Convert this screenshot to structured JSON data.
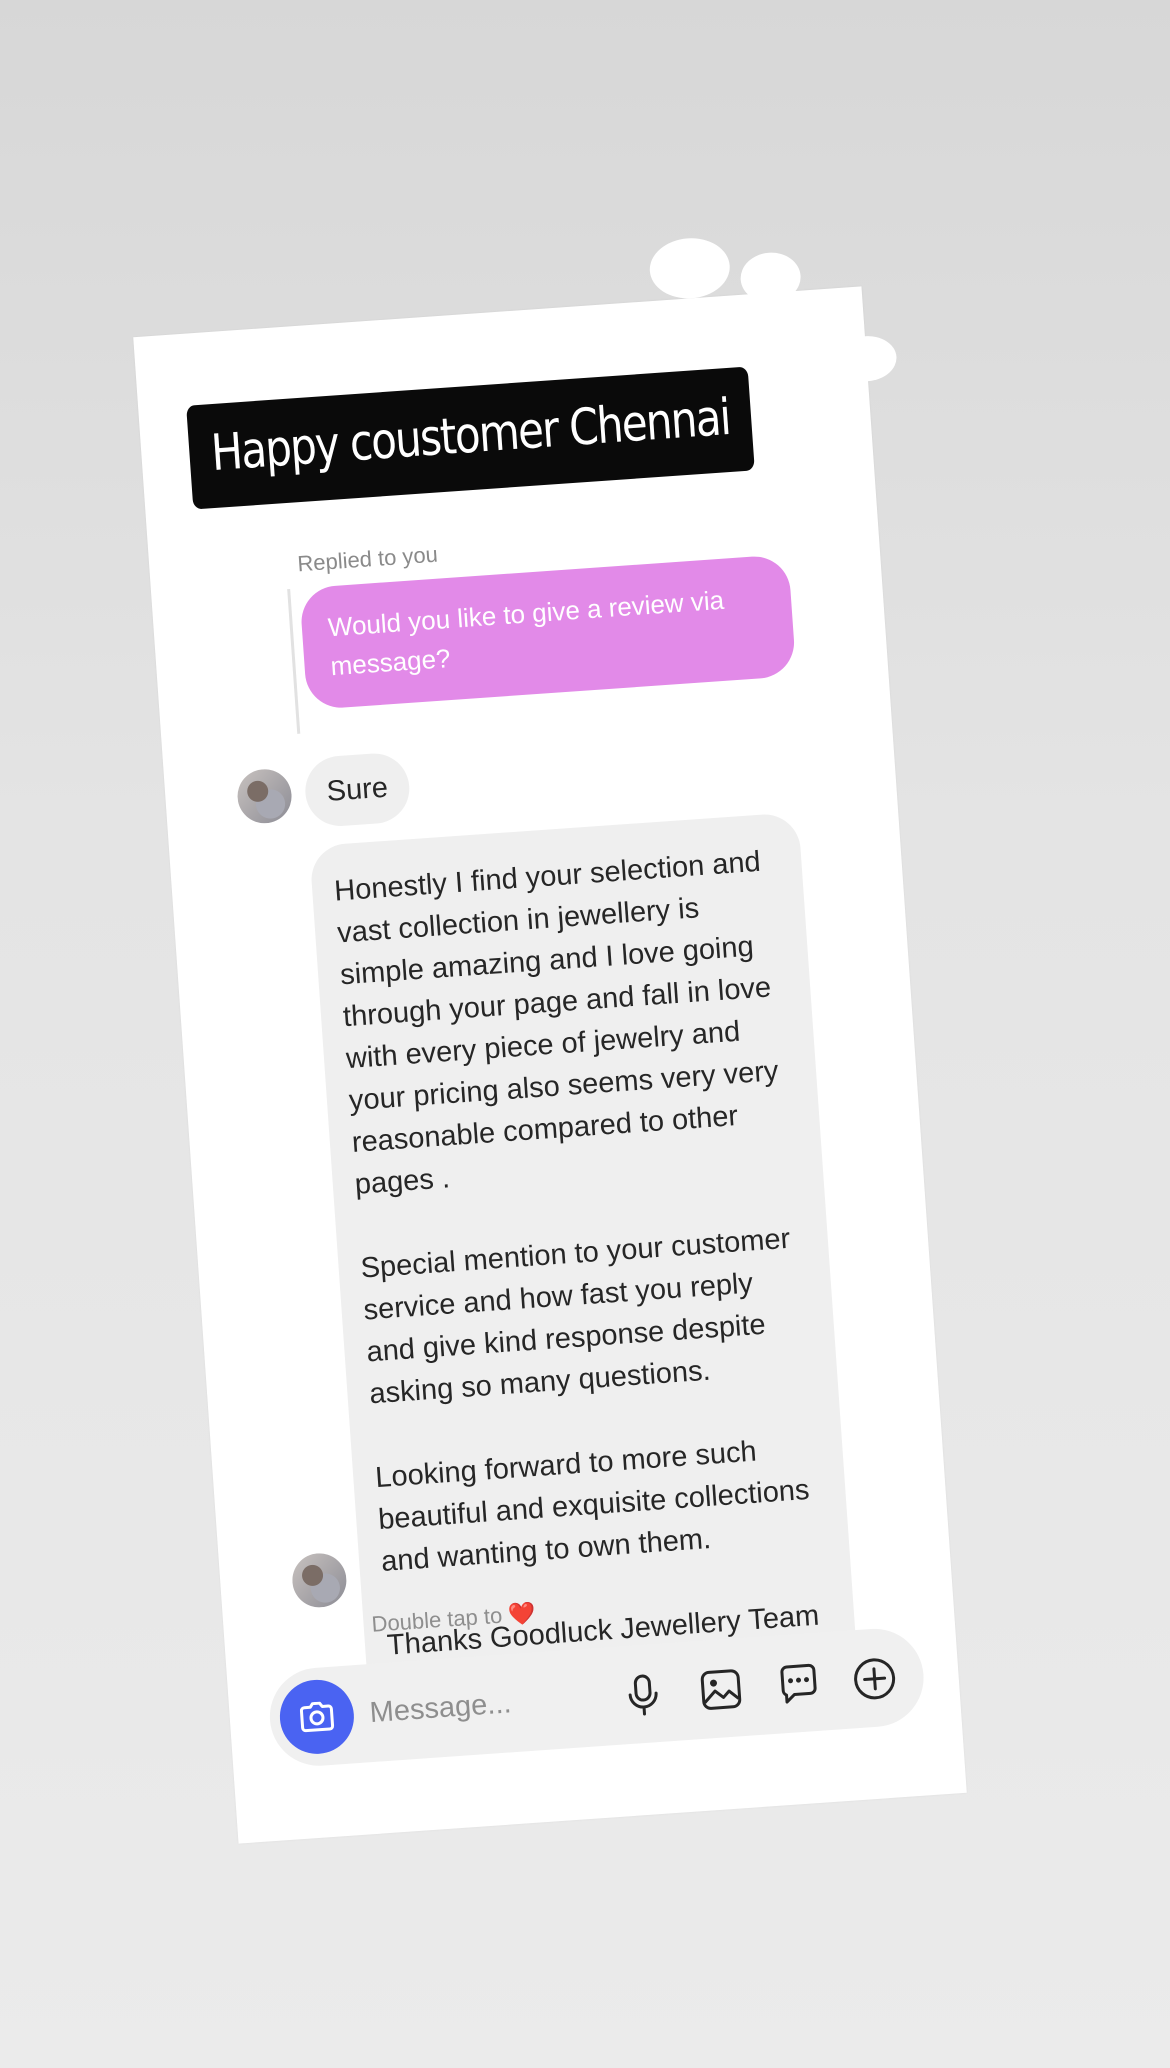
{
  "story": {
    "title_tag": "Happy coustomer Chennai"
  },
  "thread": {
    "replied_label": "Replied to you",
    "reply_text": "Would you like to give a review via message?",
    "short_reply": "Sure",
    "review_paragraphs": [
      "Honestly I find your selection and vast collection in jewellery is simple amazing and I love going through your page and fall in love with every piece of jewelry and your pricing also seems very very reasonable compared to other pages .",
      "Special mention to your customer service and how fast you reply and give kind response despite asking so many questions.",
      "Looking forward to more such beautiful and exquisite collections and  wanting to own them.",
      "Thanks Goodluck Jewellery Team"
    ],
    "review_emoji": "❣️❣️",
    "double_tap_text": "Double tap to",
    "double_tap_emoji": "❤️"
  },
  "composer": {
    "placeholder": "Message...",
    "icons": [
      "camera-icon",
      "microphone-icon",
      "gallery-icon",
      "sticker-chat-icon",
      "add-icon"
    ]
  },
  "colors": {
    "sent_bubble": "#e28ae8",
    "received_bubble": "#efefef",
    "camera_button": "#4a63f2",
    "title_tag_bg": "#0a0a0a",
    "heart": "#e0323e"
  }
}
